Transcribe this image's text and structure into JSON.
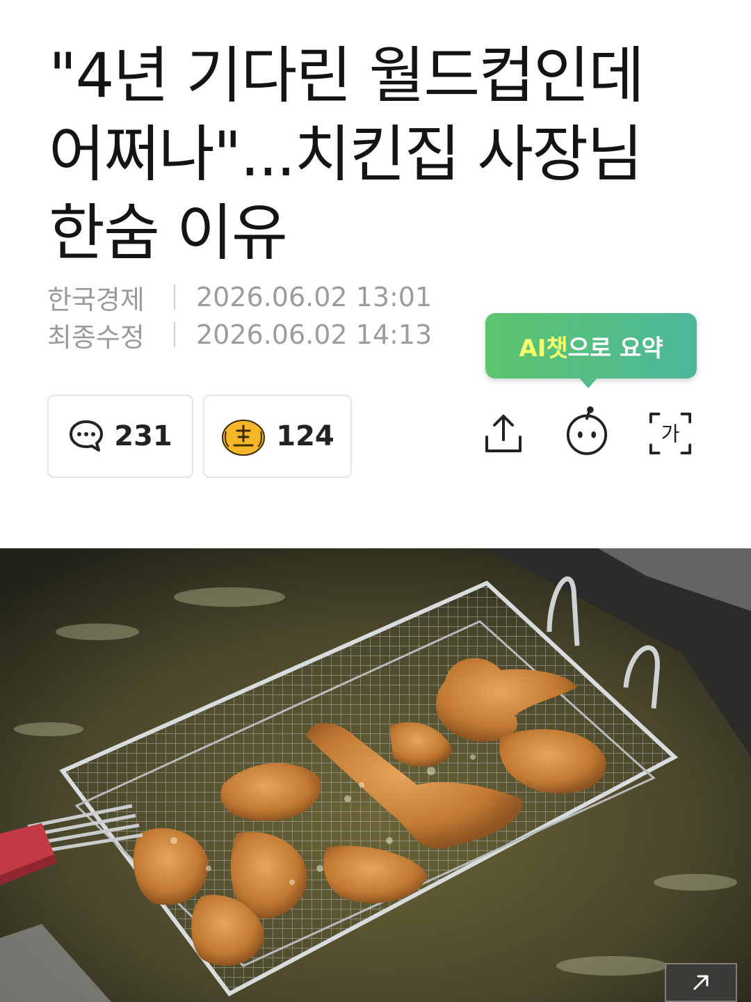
{
  "article": {
    "headline": "\"4년 기다린 월드컵인데 어쩌나\"...치킨집 사장님 한숨 이유",
    "publisher_label": "한국경제",
    "published_at": "2026.06.02 13:01",
    "modified_label": "최종수정",
    "modified_at": "2026.06.02 14:13"
  },
  "ai_summary": {
    "highlight": "AI챗",
    "rest": "으로 요약"
  },
  "reactions": {
    "comment_count": "231",
    "reaction_count": "124"
  },
  "toolbar": {
    "icons": [
      "share-icon",
      "ai-bot-icon",
      "font-size-icon"
    ],
    "font_glyph": "가"
  },
  "colors": {
    "ai_gradient_start": "#5ec46e",
    "ai_gradient_end": "#4cb89b",
    "ai_highlight": "#f6ff6a",
    "reaction_face": "#f5b728"
  }
}
